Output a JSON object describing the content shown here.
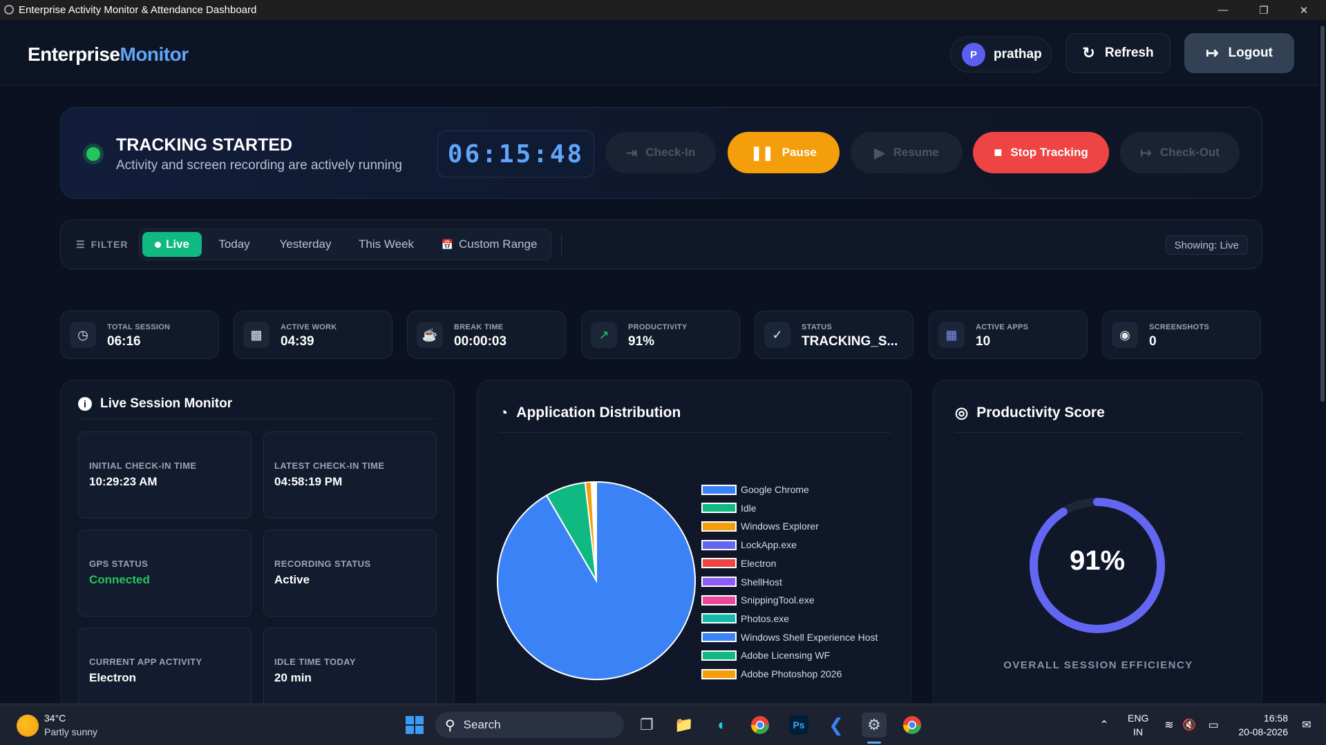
{
  "window": {
    "title": "Enterprise Activity Monitor & Attendance Dashboard"
  },
  "header": {
    "logo_part1": "Enterprise",
    "logo_part2": "Monitor",
    "user_initial": "P",
    "user_name": "prathap",
    "refresh_label": "Refresh",
    "logout_label": "Logout"
  },
  "tracking": {
    "title": "TRACKING STARTED",
    "subtitle": "Activity and screen recording are actively running",
    "timer": "06:15:48",
    "checkin_label": "Check-In",
    "pause_label": "Pause",
    "resume_label": "Resume",
    "stop_label": "Stop Tracking",
    "checkout_label": "Check-Out"
  },
  "filter": {
    "label": "FILTER",
    "options": [
      "Live",
      "Today",
      "Yesterday",
      "This Week",
      "Custom Range"
    ],
    "active": "Live",
    "showing": "Showing: Live"
  },
  "stats": [
    {
      "label": "TOTAL SESSION",
      "value": "06:16",
      "icon": "clock-icon"
    },
    {
      "label": "ACTIVE WORK",
      "value": "04:39",
      "icon": "briefcase-icon"
    },
    {
      "label": "BREAK TIME",
      "value": "00:00:03",
      "icon": "coffee-icon"
    },
    {
      "label": "PRODUCTIVITY",
      "value": "91%",
      "icon": "trending-up-icon"
    },
    {
      "label": "STATUS",
      "value": "TRACKING_S...",
      "icon": "shield-icon"
    },
    {
      "label": "ACTIVE APPS",
      "value": "10",
      "icon": "grid-icon"
    },
    {
      "label": "SCREENSHOTS",
      "value": "0",
      "icon": "camera-icon"
    }
  ],
  "live_monitor": {
    "title": "Live Session Monitor",
    "items": [
      {
        "label": "INITIAL CHECK-IN TIME",
        "value": "10:29:23 AM"
      },
      {
        "label": "LATEST CHECK-IN TIME",
        "value": "04:58:19 PM"
      },
      {
        "label": "GPS STATUS",
        "value": "Connected"
      },
      {
        "label": "RECORDING STATUS",
        "value": "Active"
      },
      {
        "label": "CURRENT APP ACTIVITY",
        "value": "Electron"
      },
      {
        "label": "IDLE TIME TODAY",
        "value": "20 min"
      }
    ],
    "colors": {
      "connected": "#22c55e"
    }
  },
  "app_distribution": {
    "title": "Application Distribution"
  },
  "chart_data": {
    "type": "pie",
    "categories": [
      "Google Chrome",
      "Idle",
      "Windows Explorer",
      "LockApp.exe",
      "Electron",
      "ShellHost",
      "SnippingTool.exe",
      "Photos.exe",
      "Windows Shell Experience Host",
      "Adobe Licensing WF",
      "Adobe Photoshop 2026"
    ],
    "values": [
      91.6,
      6.6,
      1.0,
      0.2,
      0.2,
      0.1,
      0.1,
      0.05,
      0.05,
      0.05,
      0.05
    ],
    "colors": [
      "#3b82f6",
      "#10b981",
      "#f59e0b",
      "#6366f1",
      "#ef4444",
      "#8b5cf6",
      "#ec4899",
      "#14b8a6",
      "#3b82f6",
      "#10b981",
      "#f59e0b"
    ],
    "legend_position": "right"
  },
  "productivity": {
    "title": "Productivity Score",
    "score_text": "91%",
    "score_fraction": 0.91,
    "caption": "OVERALL SESSION EFFICIENCY",
    "ring_color": "#6366f1"
  },
  "taskbar": {
    "weather_temp": "34°C",
    "weather_desc": "Partly sunny",
    "search_label": "Search",
    "lang_line1": "ENG",
    "lang_line2": "IN",
    "time": "16:58",
    "date": "20-08-2026"
  }
}
